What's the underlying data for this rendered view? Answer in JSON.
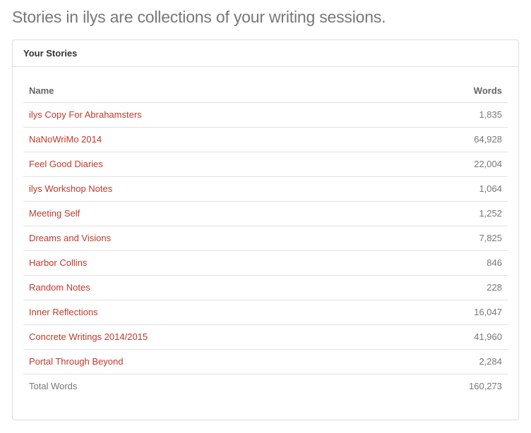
{
  "page": {
    "headline": "Stories in ilys are collections of your writing sessions."
  },
  "panel": {
    "title": "Your Stories"
  },
  "table": {
    "columns": [
      "Name",
      "Words"
    ],
    "rows": [
      {
        "name": "ilys Copy For Abrahamsters",
        "words": "1,835"
      },
      {
        "name": "NaNoWriMo 2014",
        "words": "64,928"
      },
      {
        "name": "Feel Good Diaries",
        "words": "22,004"
      },
      {
        "name": "ilys Workshop Notes",
        "words": "1,064"
      },
      {
        "name": "Meeting Self",
        "words": "1,252"
      },
      {
        "name": "Dreams and Visions",
        "words": "7,825"
      },
      {
        "name": "Harbor Collins",
        "words": "846"
      },
      {
        "name": "Random Notes",
        "words": "228"
      },
      {
        "name": "Inner Reflections",
        "words": "16,047"
      },
      {
        "name": "Concrete Writings 2014/2015",
        "words": "41,960"
      },
      {
        "name": "Portal Through Beyond",
        "words": "2,284"
      }
    ],
    "total": {
      "label": "Total Words",
      "words": "160,273"
    }
  },
  "colors": {
    "link": "#c0392b",
    "border": "#dddddd",
    "muted_text": "#777777"
  }
}
